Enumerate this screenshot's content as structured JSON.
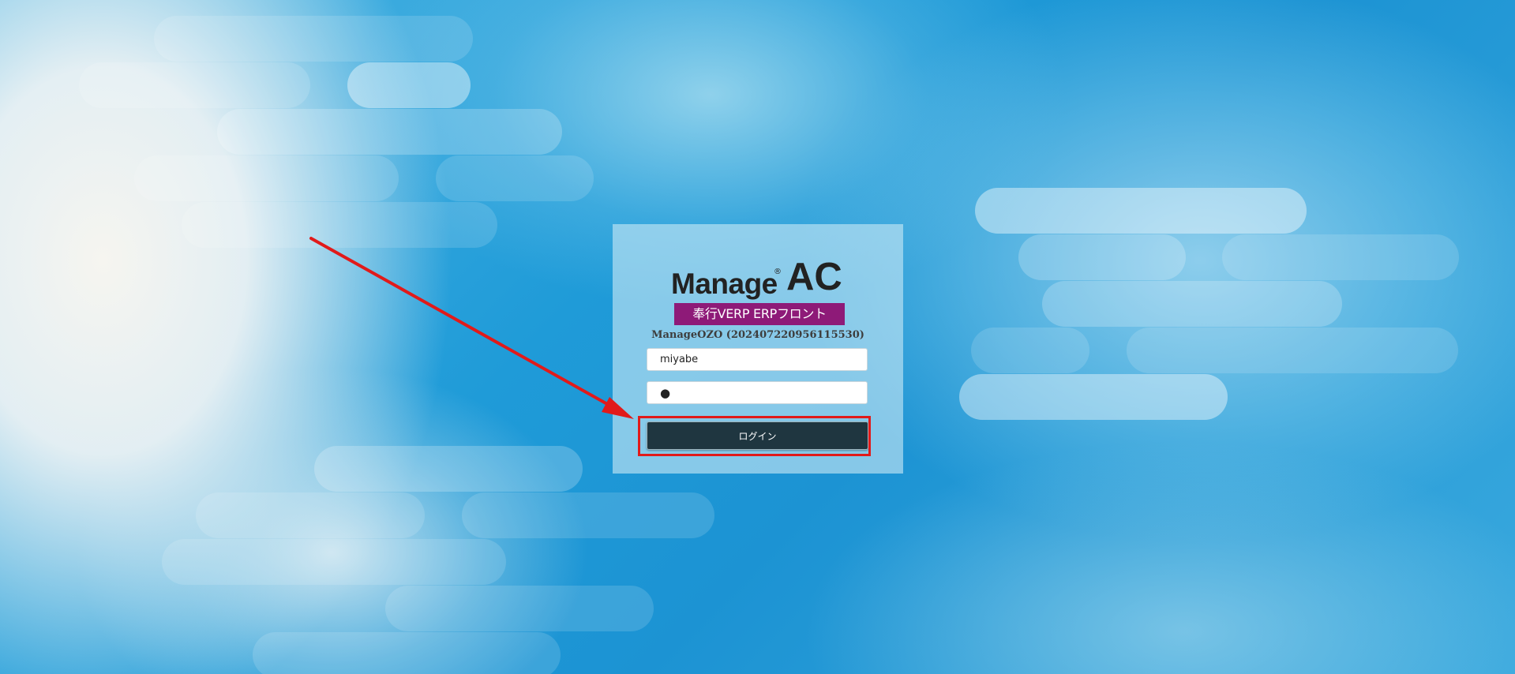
{
  "logo": {
    "manage_text": "Manage",
    "reg_mark": "®",
    "ac_text": "AC",
    "badge_text": "奉行VERP ERPフロント"
  },
  "version_text": "ManageOZO (202407220956115530)",
  "form": {
    "username_value": "miyabe",
    "password_value": "●",
    "login_label": "ログイン"
  },
  "colors": {
    "badge": "#8e1a78",
    "login_button": "#1f3640",
    "annotation": "#e11a1a"
  }
}
